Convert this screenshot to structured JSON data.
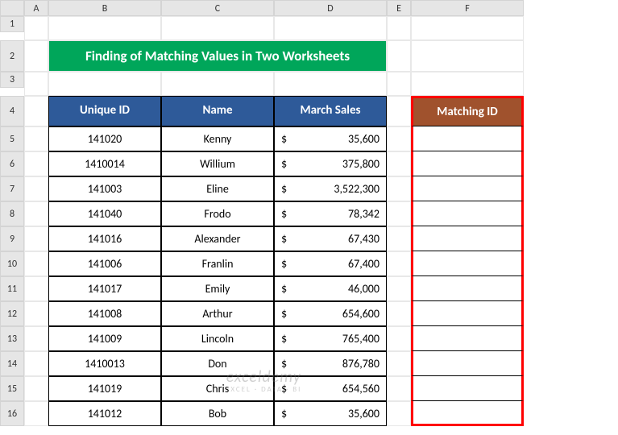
{
  "columns": [
    "",
    "A",
    "B",
    "C",
    "D",
    "E",
    "F"
  ],
  "row_numbers": [
    "1",
    "2",
    "3",
    "4",
    "5",
    "6",
    "7",
    "8",
    "9",
    "10",
    "11",
    "12",
    "13",
    "14",
    "15",
    "16"
  ],
  "title": "Finding of Matching Values in Two Worksheets",
  "headers": {
    "b": "Unique ID",
    "c": "Name",
    "d": "March Sales",
    "f": "Matching ID"
  },
  "currency": "$",
  "rows": [
    {
      "id": "141020",
      "name": "Kenny",
      "sales": "35,600"
    },
    {
      "id": "1410014",
      "name": "Willium",
      "sales": "375,800"
    },
    {
      "id": "141003",
      "name": "Eline",
      "sales": "3,522,300"
    },
    {
      "id": "141040",
      "name": "Frodo",
      "sales": "78,342"
    },
    {
      "id": "141016",
      "name": "Alexander",
      "sales": "67,430"
    },
    {
      "id": "141006",
      "name": "Franlin",
      "sales": "67,400"
    },
    {
      "id": "141017",
      "name": "Emily",
      "sales": "46,000"
    },
    {
      "id": "141008",
      "name": "Arthur",
      "sales": "654,600"
    },
    {
      "id": "141009",
      "name": "Lincoln",
      "sales": "765,400"
    },
    {
      "id": "1410013",
      "name": "Don",
      "sales": "876,780"
    },
    {
      "id": "141019",
      "name": "Chris",
      "sales": "654,560"
    },
    {
      "id": "141012",
      "name": "Bob",
      "sales": "35,600"
    }
  ],
  "watermark": {
    "line1": "exceldemy",
    "line2": "EXCEL · DATA · BI"
  }
}
